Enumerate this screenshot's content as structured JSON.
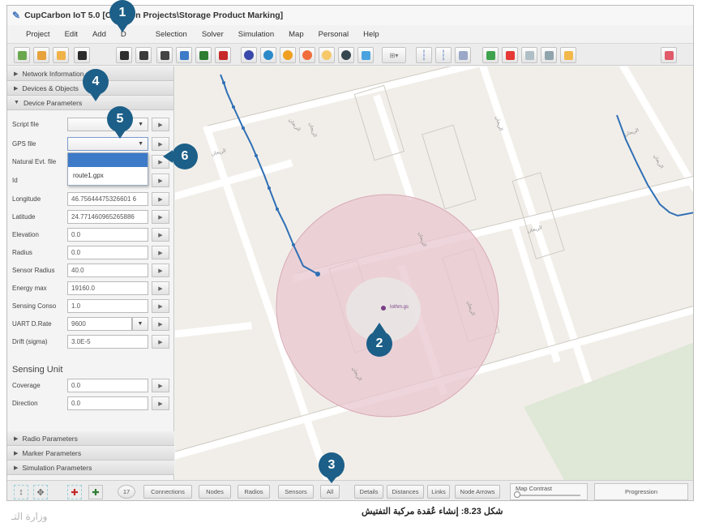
{
  "window": {
    "title": "CupCarbon IoT 5.0 [C:\\C  bon Projects\\Storage Product Marking]"
  },
  "menu": [
    "Project",
    "Edit",
    "Add",
    "D",
    "Selection",
    "Solver",
    "Simulation",
    "Map",
    "Personal",
    "Help"
  ],
  "sidebar": {
    "top_sections": [
      {
        "label": "Network Information",
        "expanded": false
      },
      {
        "label": "Devices & Objects",
        "expanded": false
      },
      {
        "label": "Device Parameters",
        "expanded": true
      }
    ],
    "params": [
      {
        "label": "Script file",
        "kind": "combo",
        "value": ""
      },
      {
        "label": "GPS file",
        "kind": "combo",
        "value": ""
      },
      {
        "label": "Natural Evt. file",
        "kind": "combo",
        "value": ""
      },
      {
        "label": "Id",
        "kind": "text",
        "value": ""
      },
      {
        "label": "Longitude",
        "kind": "text",
        "value": "46.75644475326601 6"
      },
      {
        "label": "Latitude",
        "kind": "text",
        "value": "24.771460965265886"
      },
      {
        "label": "Elevation",
        "kind": "text",
        "value": "0.0"
      },
      {
        "label": "Radius",
        "kind": "text",
        "value": "0.0"
      },
      {
        "label": "Sensor Radius",
        "kind": "text",
        "value": "40.0"
      },
      {
        "label": "Energy max",
        "kind": "text",
        "value": "19160.0"
      },
      {
        "label": "Sensing Conso",
        "kind": "text",
        "value": "1.0"
      },
      {
        "label": "UART D.Rate",
        "kind": "select",
        "value": "9600"
      },
      {
        "label": "Drift (sigma)",
        "kind": "text",
        "value": "3.0E-5"
      }
    ],
    "gps_dropdown": {
      "options": [
        "",
        "route1.gpx"
      ]
    },
    "sensing_unit": {
      "title": "Sensing Unit",
      "params": [
        {
          "label": "Coverage",
          "value": "0.0"
        },
        {
          "label": "Direction",
          "value": "0.0"
        }
      ]
    },
    "bottom_sections": [
      {
        "label": "Radio Parameters"
      },
      {
        "label": "Marker Parameters"
      },
      {
        "label": "Simulation Parameters"
      }
    ],
    "param_button_glyph": "▶"
  },
  "map": {
    "node_label": "Iothm.gs",
    "street_labels": [
      "الريحان",
      "الريحان",
      "الريحان",
      "الريحان",
      "الريحان",
      "الريحان",
      "الريحان",
      "الريحان",
      "الريحان",
      "الريحان"
    ],
    "coverage_color": "#e8c7cf",
    "route_color": "#2f6fb5"
  },
  "bottombar": {
    "counter": "17",
    "buttons": [
      "Connections",
      "Nodes",
      "Radios",
      "Sensors",
      "All",
      "Details",
      "Distances",
      "Links",
      "Node Arrows"
    ],
    "map_contrast_label": "Map Contrast",
    "progression_label": "Progression"
  },
  "callouts": [
    "1",
    "2",
    "3",
    "4",
    "5",
    "6"
  ],
  "caption": "شكل 8.23: إنشاء عُقدة مركبة التفتيش",
  "ministry": "وزارة التـ"
}
